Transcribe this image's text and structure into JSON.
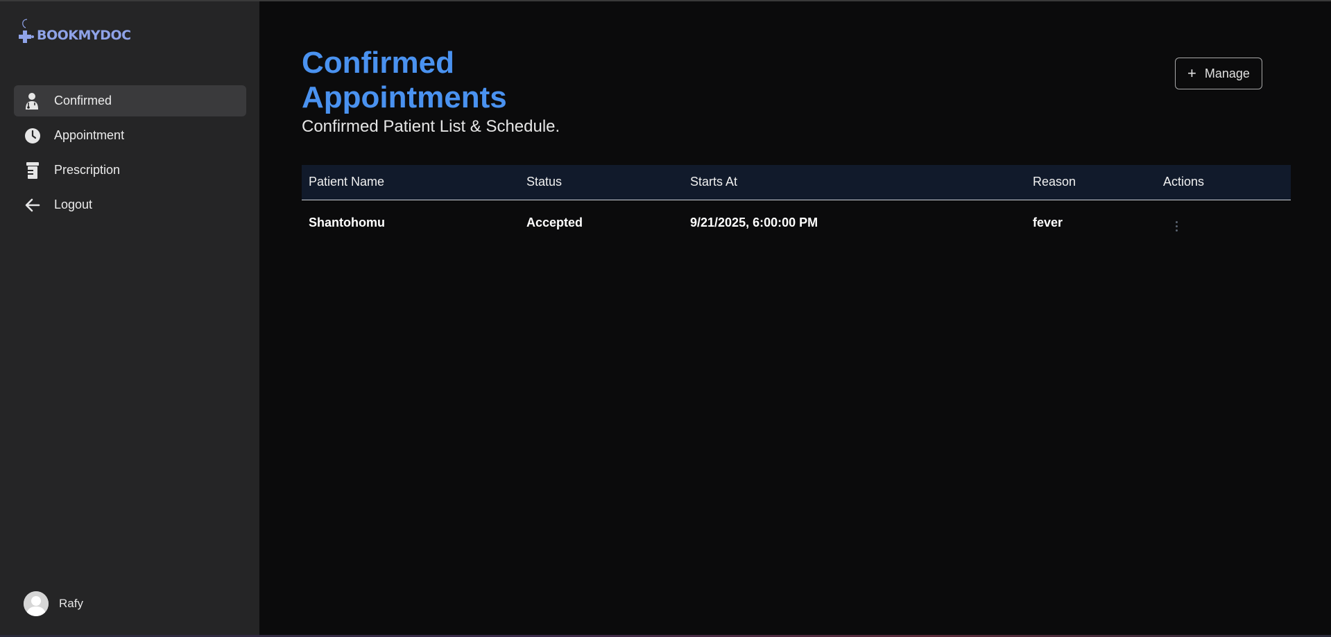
{
  "app": {
    "logo_text": "BOOKMYDOC",
    "accent_color": "#4a92f0",
    "logo_color": "#8fa3e8"
  },
  "sidebar": {
    "items": [
      {
        "label": "Confirmed",
        "icon": "doctor-icon",
        "active": true
      },
      {
        "label": "Appointment",
        "icon": "clock-icon",
        "active": false
      },
      {
        "label": "Prescription",
        "icon": "prescription-bottle-icon",
        "active": false
      },
      {
        "label": "Logout",
        "icon": "arrow-left-icon",
        "active": false
      }
    ],
    "user": {
      "name": "Rafy",
      "avatar_icon": "user-avatar-icon"
    }
  },
  "main": {
    "title": "Confirmed Appointments",
    "subtitle": "Confirmed Patient List & Schedule.",
    "manage_button": {
      "label": "Manage",
      "icon": "plus-icon"
    },
    "table": {
      "columns": [
        "Patient Name",
        "Status",
        "Starts At",
        "Reason",
        "Actions"
      ],
      "rows": [
        {
          "patient_name": "Shantohomu",
          "status": "Accepted",
          "starts_at": "9/21/2025, 6:00:00 PM",
          "reason": "fever",
          "actions_icon": "kebab-menu-icon"
        }
      ]
    }
  }
}
